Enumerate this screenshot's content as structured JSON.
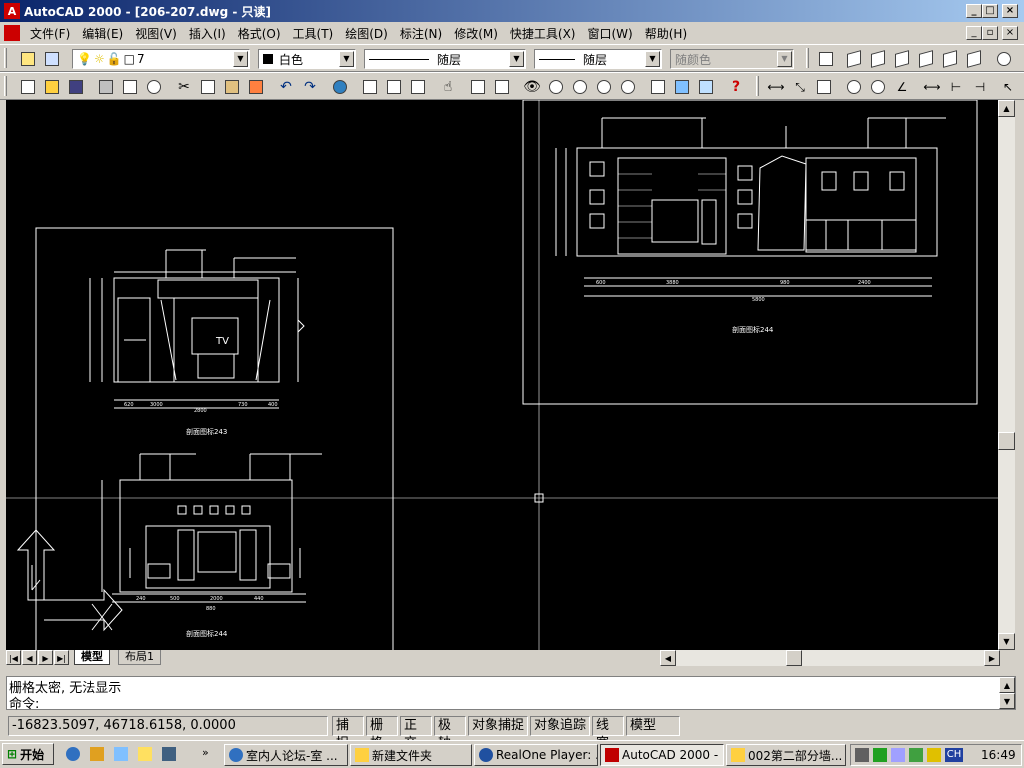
{
  "window": {
    "title": "AutoCAD 2000 - [206-207.dwg - 只读]"
  },
  "menu": [
    "文件(F)",
    "编辑(E)",
    "视图(V)",
    "插入(I)",
    "格式(O)",
    "工具(T)",
    "绘图(D)",
    "标注(N)",
    "修改(M)",
    "快捷工具(X)",
    "窗口(W)",
    "帮助(H)"
  ],
  "toolbar": {
    "layer_value": "7",
    "color_value": "白色",
    "linetype_value": "随层",
    "lineweight_value": "随层",
    "plotstyle_value": "随颜色"
  },
  "drawing": {
    "captions": [
      "剖面图标243",
      "剖面图标244",
      "剖面图标244"
    ],
    "dimensions": {
      "a1": [
        "620",
        "2800",
        "3000",
        "730",
        "400"
      ],
      "a2": [
        "240",
        "500",
        "2000",
        "440",
        "880"
      ],
      "a3": [
        "5800",
        "3880",
        "980",
        "600",
        "2400"
      ]
    },
    "tv_label": "TV"
  },
  "tabs": {
    "model": "模型",
    "layout1": "布局1"
  },
  "command": {
    "history": "栅格太密, 无法显示",
    "prompt": "命令:"
  },
  "status": {
    "coords": "-16823.5097, 46718.6158, 0.0000",
    "snap": "捕捉",
    "grid": "栅格",
    "ortho": "正交",
    "polar": "极轴",
    "osnap": "对象捕捉",
    "otrack": "对象追踪",
    "lwt": "线宽",
    "model": "模型"
  },
  "taskbar": {
    "start": "开始",
    "tasks": [
      "室内人论坛-室 ...",
      "新建文件夹",
      "RealOne Player: ...",
      "AutoCAD 2000 - [...",
      "002第二部分墙..."
    ],
    "lang": "CH",
    "clock": "16:49"
  },
  "colors": {
    "titlebar_start": "#0a246a",
    "titlebar_end": "#a6caf0",
    "canvas": "#000000",
    "linework": "#ffffff"
  }
}
